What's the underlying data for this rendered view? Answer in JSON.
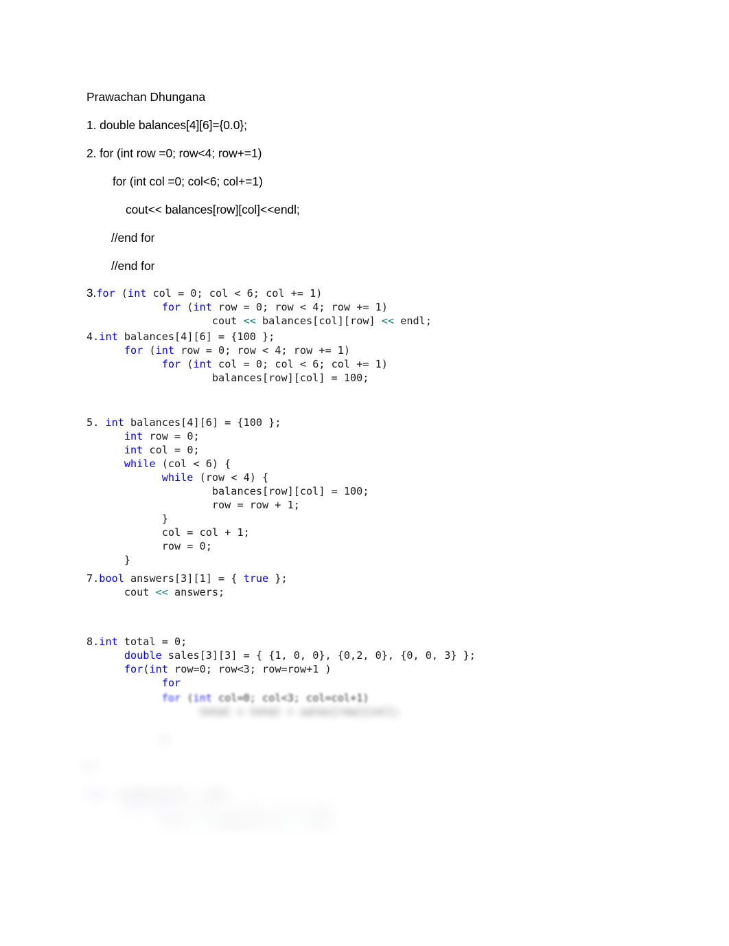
{
  "document": {
    "author_name": "Prawachan Dhungana",
    "background_color": "#ffffff",
    "text_color": "#000000",
    "keyword_color": "#0000ff",
    "operator_color": "#0d7d7d"
  },
  "prose": {
    "lines": [
      {
        "indent": 0,
        "text": "1. double balances[4][6]={0.0};"
      },
      {
        "indent": 0,
        "text": "2. for (int row =0; row<4; row+=1)"
      },
      {
        "indent": 1,
        "text": "for (int col =0; col<6; col+=1)"
      },
      {
        "indent": 2,
        "text": "cout<< balances[row][col]<<endl;"
      },
      {
        "indent": 3,
        "text": "//end for"
      },
      {
        "indent": 3,
        "text": "//end for"
      }
    ]
  },
  "sections": {
    "sec3": {
      "marker": "3.",
      "lines": [
        "for (int col = 0; col < 6; col += 1)",
        "            for (int row = 0; row < 4; row += 1)",
        "                    cout << balances[col][row] << endl;"
      ]
    },
    "sec4": {
      "marker": "4.",
      "lines": [
        "int balances[4][6] = {100 };",
        "      for (int row = 0; row < 4; row += 1)",
        "            for (int col = 0; col < 6; col += 1)",
        "                    balances[row][col] = 100;"
      ]
    },
    "sec5": {
      "marker": "5. ",
      "lines": [
        "int balances[4][6] = {100 };",
        "      int row = 0;",
        "      int col = 0;",
        "      while (col < 6) {",
        "            while (row < 4) {",
        "                    balances[row][col] = 100;",
        "                    row = row + 1;",
        "            }",
        "            col = col + 1;",
        "            row = 0;",
        "      }"
      ]
    },
    "sec7": {
      "marker": "7.",
      "lines": [
        "bool answers[3][1] = { true };",
        "      cout << answers;"
      ]
    },
    "sec8": {
      "marker": "8.",
      "lines": [
        "int total = 0;",
        "      double sales[3][3] = { {1, 0, 0}, {0,2, 0}, {0, 0, 3} };",
        "      for(int row=0; row<3; row=row+1 )",
        "            for"
      ]
    }
  },
  "blurred_tail": {
    "note": "Remaining content is obscured by a progressive blur fade.",
    "lines": [
      "            for (int col=0; col<3; col=col+1)",
      "                  total = total + sales[row][col];",
      "",
      "            }",
      "",
      "9.",
      "",
      "int  examples[5] = {0};",
      "      for (int i = 0; i < 5; i = i + 1)",
      "            cout << examples[i] << endl;"
    ]
  }
}
